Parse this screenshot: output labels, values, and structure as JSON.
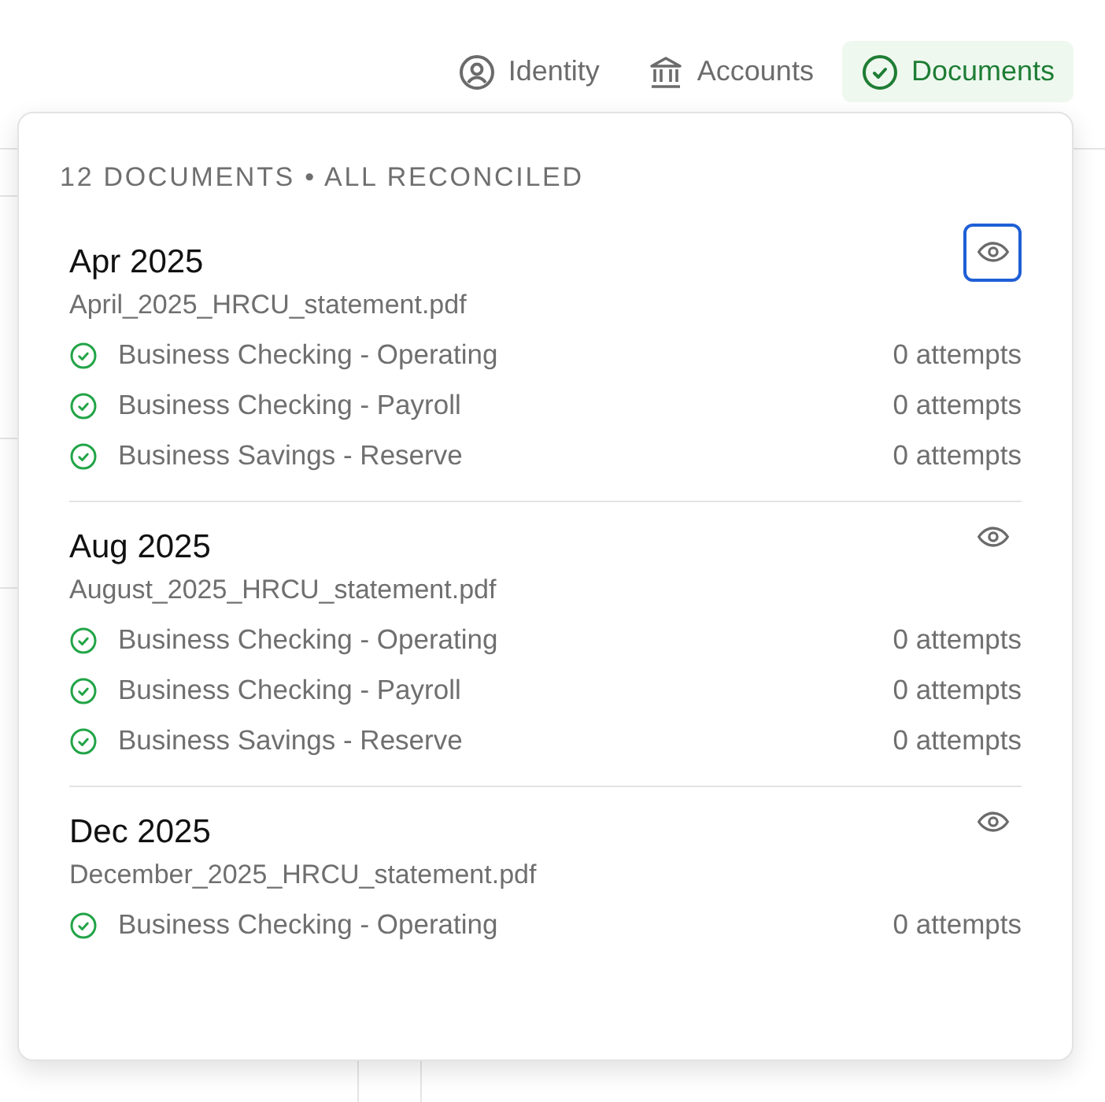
{
  "tabs": [
    {
      "kind": "person",
      "label": "Identity",
      "selected": false
    },
    {
      "kind": "bank",
      "label": "Accounts",
      "selected": false
    },
    {
      "kind": "check",
      "label": "Documents",
      "selected": true
    }
  ],
  "popover": {
    "summary": "12 DOCUMENTS • ALL RECONCILED",
    "documents": [
      {
        "period": "Apr 2025",
        "file": "April_2025_HRCU_statement.pdf",
        "focused": true,
        "accounts": [
          {
            "name": "Business Checking - Operating",
            "attempts": "0 attempts",
            "reconciled": true
          },
          {
            "name": "Business Checking - Payroll",
            "attempts": "0 attempts",
            "reconciled": true
          },
          {
            "name": "Business Savings - Reserve",
            "attempts": "0 attempts",
            "reconciled": true
          }
        ]
      },
      {
        "period": "Aug 2025",
        "file": "August_2025_HRCU_statement.pdf",
        "focused": false,
        "accounts": [
          {
            "name": "Business Checking - Operating",
            "attempts": "0 attempts",
            "reconciled": true
          },
          {
            "name": "Business Checking - Payroll",
            "attempts": "0 attempts",
            "reconciled": true
          },
          {
            "name": "Business Savings - Reserve",
            "attempts": "0 attempts",
            "reconciled": true
          }
        ]
      },
      {
        "period": "Dec 2025",
        "file": "December_2025_HRCU_statement.pdf",
        "focused": false,
        "accounts": [
          {
            "name": "Business Checking - Operating",
            "attempts": "0 attempts",
            "reconciled": true
          }
        ]
      }
    ]
  }
}
